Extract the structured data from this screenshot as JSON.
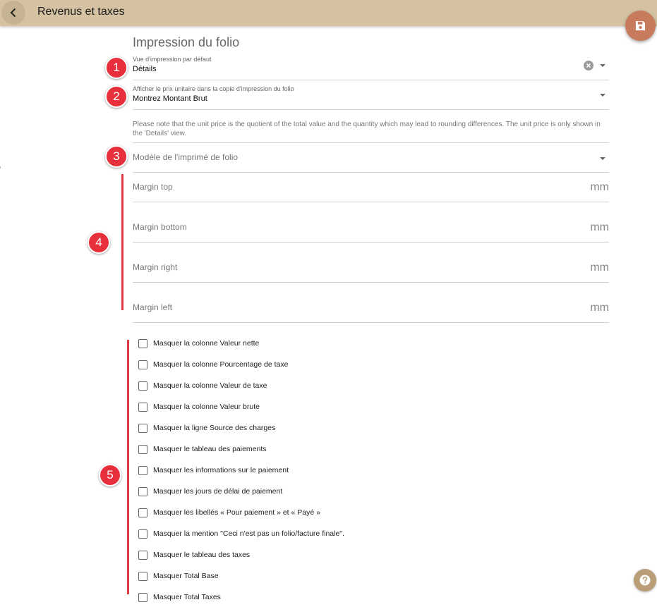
{
  "header": {
    "title": "Revenus et taxes"
  },
  "section": {
    "title": "Impression du folio"
  },
  "fields": {
    "default_view": {
      "label": "Vue d'impression par défaut",
      "value": "Détails"
    },
    "unit_price": {
      "label": "Afficher le prix unitaire dans la copie d'impression du folio",
      "value": "Montrez Montant Brut"
    },
    "note": "Please note that the unit price is the quotient of the total value and the quantity which may lead to rounding differences. The unit price is only shown in the 'Details' view.",
    "template": {
      "label": "Modèle de l'imprimé de folio"
    }
  },
  "margins": {
    "unit": "mm",
    "items": [
      {
        "label": "Margin top"
      },
      {
        "label": "Margin bottom"
      },
      {
        "label": "Margin right"
      },
      {
        "label": "Margin left"
      }
    ]
  },
  "checkboxes": [
    {
      "label": "Masquer la colonne Valeur nette",
      "checked": false
    },
    {
      "label": "Masquer la colonne Pourcentage de taxe",
      "checked": false
    },
    {
      "label": "Masquer la colonne Valeur de taxe",
      "checked": false
    },
    {
      "label": "Masquer la colonne Valeur brute",
      "checked": false
    },
    {
      "label": "Masquer la ligne Source des charges",
      "checked": false
    },
    {
      "label": "Masquer le tableau des paiements",
      "checked": false
    },
    {
      "label": "Masquer les informations sur le paiement",
      "checked": false
    },
    {
      "label": "Masquer les jours de délai de paiement",
      "checked": false
    },
    {
      "label": "Masquer les libellés « Pour paiement » et « Payé »",
      "checked": false
    },
    {
      "label": "Masquer la mention \"Ceci n'est pas un folio/facture finale\".",
      "checked": false
    },
    {
      "label": "Masquer le tableau des taxes",
      "checked": false
    },
    {
      "label": "Masquer Total Base",
      "checked": false
    },
    {
      "label": "Masquer Total Taxes",
      "checked": false
    }
  ],
  "markers": [
    "1",
    "2",
    "3",
    "4",
    "5"
  ],
  "icons": {
    "back": "chevron-left-icon",
    "save": "floppy-disk-icon",
    "help": "question-mark-icon",
    "clear": "clear-circle-icon",
    "dropdown": "caret-down-icon"
  },
  "colors": {
    "header": "#d4c2a3",
    "save_fab": "#c77a5c",
    "help_fab": "#b99e78",
    "marker": "#e8303c"
  }
}
